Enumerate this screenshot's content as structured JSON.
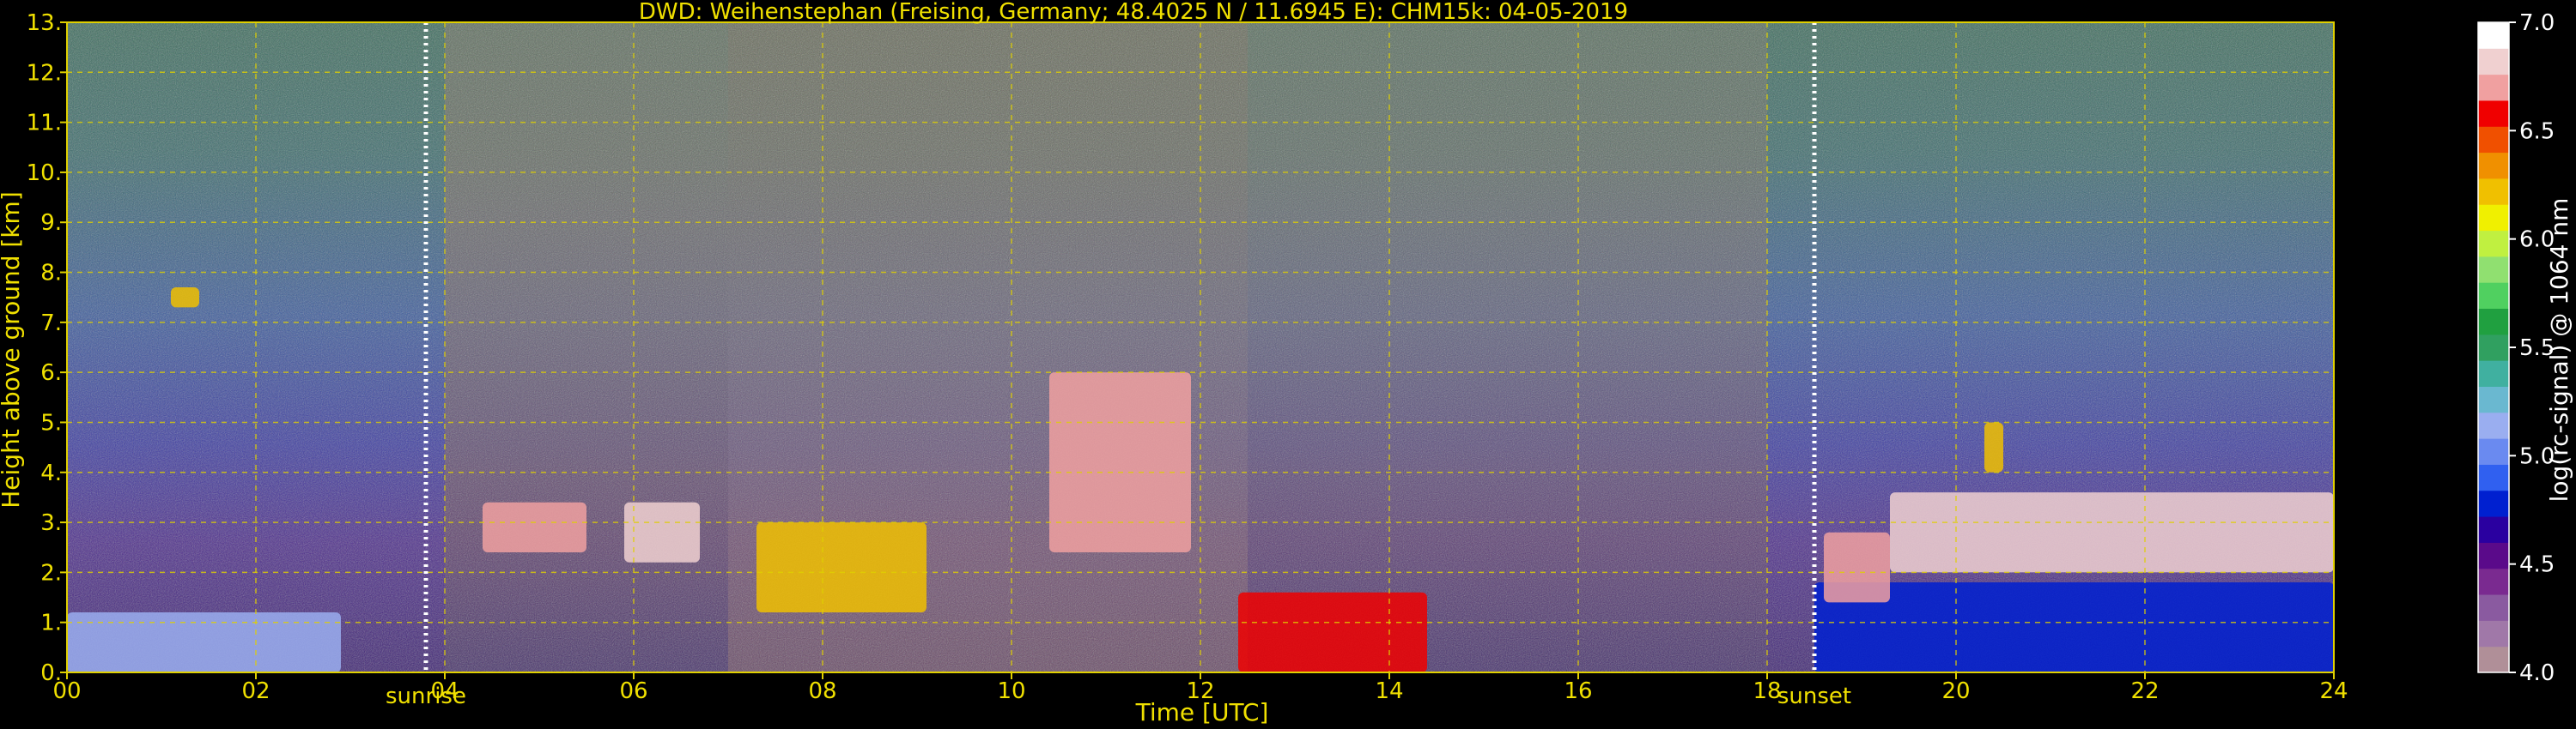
{
  "chart_data": {
    "type": "heatmap",
    "title": "DWD: Weihenstephan (Freising, Germany; 48.4025 N / 11.6945 E):    CHM15k: 04-05-2019",
    "xlabel": "Time [UTC]",
    "ylabel": "Height above ground [km]",
    "xlim": [
      0,
      24
    ],
    "ylim": [
      0,
      13
    ],
    "x_ticks": [
      "00",
      "02",
      "04",
      "06",
      "08",
      "10",
      "12",
      "14",
      "16",
      "18",
      "20",
      "22",
      "24"
    ],
    "y_ticks": [
      "0.",
      "1.",
      "2.",
      "3.",
      "4.",
      "5.",
      "6.",
      "7.",
      "8.",
      "9.",
      "10.",
      "11.",
      "12.",
      "13."
    ],
    "grid": true,
    "markers": [
      {
        "label": "sunrise",
        "x": 3.8
      },
      {
        "label": "sunset",
        "x": 18.5
      }
    ],
    "colorbar": {
      "label": "log(rc-signal) @ 1064 nm",
      "range": [
        4.0,
        7.0
      ],
      "ticks": [
        "4.0",
        "4.5",
        "5.0",
        "5.5",
        "6.0",
        "6.5",
        "7.0"
      ],
      "colors": [
        "#b08f98",
        "#a078a8",
        "#8a5aa0",
        "#7a2a90",
        "#5a0a8a",
        "#2a00a0",
        "#0020d0",
        "#3060f0",
        "#6a8af0",
        "#9aaef0",
        "#6ab8d0",
        "#40b0a0",
        "#30a060",
        "#20a040",
        "#50d060",
        "#90e070",
        "#c0f040",
        "#f0f000",
        "#f0c000",
        "#f09000",
        "#f05000",
        "#f00000",
        "#f0a0a0",
        "#f0d0d0",
        "#ffffff"
      ]
    },
    "features": [
      {
        "name": "boundary-layer",
        "x0": 0,
        "x1": 2.9,
        "y0": 0,
        "y1": 1.2,
        "value": 5.1
      },
      {
        "name": "residual-layer",
        "x0": 18.5,
        "x1": 24,
        "y0": 0,
        "y1": 1.8,
        "value": 4.7
      },
      {
        "name": "cloud",
        "x0": 4.4,
        "x1": 5.5,
        "y0": 2.4,
        "y1": 3.4,
        "value": 6.8
      },
      {
        "name": "cloud",
        "x0": 5.9,
        "x1": 6.7,
        "y0": 2.2,
        "y1": 3.4,
        "value": 6.9
      },
      {
        "name": "cloud",
        "x0": 7.3,
        "x1": 9.1,
        "y0": 1.2,
        "y1": 3.0,
        "value": 6.3
      },
      {
        "name": "cloud",
        "x0": 10.4,
        "x1": 11.9,
        "y0": 2.4,
        "y1": 6.0,
        "value": 6.7
      },
      {
        "name": "cloud",
        "x0": 12.4,
        "x1": 14.4,
        "y0": 0,
        "y1": 1.6,
        "value": 6.6
      },
      {
        "name": "cloud",
        "x0": 18.6,
        "x1": 19.3,
        "y0": 1.4,
        "y1": 2.8,
        "value": 6.8
      },
      {
        "name": "cloud",
        "x0": 19.3,
        "x1": 24,
        "y0": 2.0,
        "y1": 3.6,
        "value": 6.9
      },
      {
        "name": "cloud",
        "x0": 20.3,
        "x1": 20.5,
        "y0": 4.0,
        "y1": 5.0,
        "value": 6.3
      },
      {
        "name": "cloud",
        "x0": 1.1,
        "x1": 1.4,
        "y0": 7.3,
        "y1": 7.7,
        "value": 6.2
      }
    ]
  }
}
